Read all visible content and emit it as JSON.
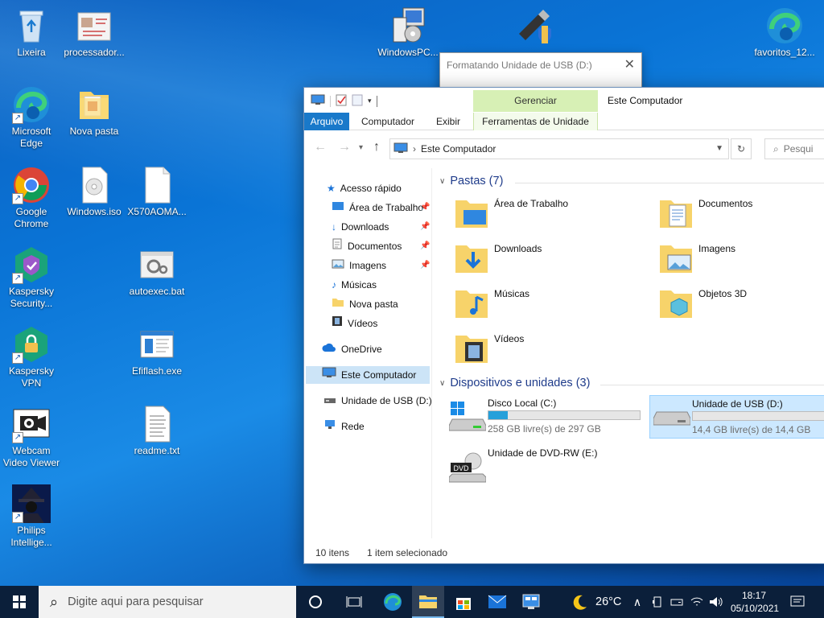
{
  "desktop": {
    "icons": [
      {
        "label": "Lixeira"
      },
      {
        "label": "processador..."
      },
      {
        "label": "Microsoft Edge"
      },
      {
        "label": "Nova pasta"
      },
      {
        "label": "Google Chrome"
      },
      {
        "label": "Windows.iso"
      },
      {
        "label": "X570AOMA..."
      },
      {
        "label": "Kaspersky Security..."
      },
      {
        "label": "autoexec.bat"
      },
      {
        "label": "Kaspersky VPN"
      },
      {
        "label": "Efiflash.exe"
      },
      {
        "label": "Webcam Video Viewer"
      },
      {
        "label": "readme.txt"
      },
      {
        "label": "Philips Intellige..."
      },
      {
        "label": "WindowsPC..."
      },
      {
        "label": "favoritos_12..."
      }
    ]
  },
  "format_dialog": {
    "title": "Formatando Unidade de USB (D:)"
  },
  "explorer": {
    "title": "Este Computador",
    "context_tab": "Gerenciar",
    "tabs": {
      "file": "Arquivo",
      "computer": "Computador",
      "view": "Exibir",
      "drive_tools": "Ferramentas de Unidade"
    },
    "address": "Este Computador",
    "search_placeholder": "Pesqui",
    "nav": {
      "quick_access": "Acesso rápido",
      "desktop": "Área de Trabalho",
      "downloads": "Downloads",
      "documents": "Documentos",
      "images": "Imagens",
      "music": "Músicas",
      "new_folder": "Nova pasta",
      "videos": "Vídeos",
      "onedrive": "OneDrive",
      "this_pc": "Este Computador",
      "usb": "Unidade de USB (D:)",
      "network": "Rede"
    },
    "folders_header": "Pastas (7)",
    "folders": {
      "desktop": "Área de Trabalho",
      "documents": "Documentos",
      "downloads": "Downloads",
      "images": "Imagens",
      "music": "Músicas",
      "objects3d": "Objetos 3D",
      "videos": "Vídeos"
    },
    "devices_header": "Dispositivos e unidades (3)",
    "drives": {
      "c": {
        "name": "Disco Local (C:)",
        "free": "258 GB livre(s) de 297 GB",
        "used_fraction": 0.13
      },
      "d": {
        "name": "Unidade de USB (D:)",
        "free": "14,4 GB livre(s) de 14,4 GB",
        "used_fraction": 0.0
      },
      "e": {
        "name": "Unidade de DVD-RW (E:)",
        "dvd_badge": "DVD"
      }
    },
    "status": {
      "items": "10 itens",
      "selected": "1 item selecionado"
    }
  },
  "taskbar": {
    "search_placeholder": "Digite aqui para pesquisar",
    "weather": "26°C",
    "time": "18:17",
    "date": "05/10/2021"
  }
}
